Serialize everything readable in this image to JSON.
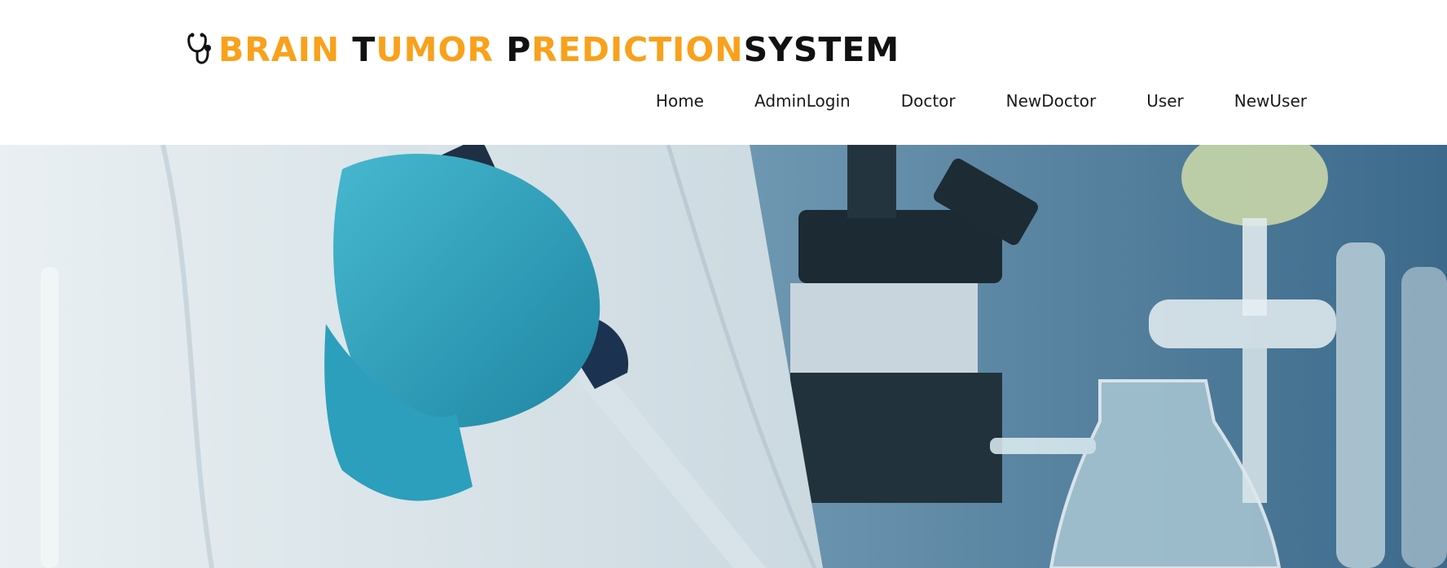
{
  "brand": {
    "title_segments": [
      {
        "text": "B",
        "color": "#f9a11b"
      },
      {
        "text": "RAIN ",
        "color": "#f9a11b"
      },
      {
        "text": "T",
        "color": "#111111"
      },
      {
        "text": "UMOR ",
        "color": "#f9a11b"
      },
      {
        "text": "P",
        "color": "#111111"
      },
      {
        "text": "REDICTION",
        "color": "#f9a11b"
      },
      {
        "text": "SYSTEM",
        "color": "#111111"
      }
    ],
    "icon": "stethoscope-icon"
  },
  "nav": {
    "items": [
      {
        "label": "Home"
      },
      {
        "label": "AdminLogin"
      },
      {
        "label": "Doctor"
      },
      {
        "label": "NewDoctor"
      },
      {
        "label": "User"
      },
      {
        "label": "NewUser"
      }
    ]
  },
  "hero": {
    "image": "laboratory-scientist-with-pipette-photo",
    "colors": {
      "glove": "#2fa6c0",
      "coat": "#e4ecef",
      "background": "#4a7796"
    }
  }
}
